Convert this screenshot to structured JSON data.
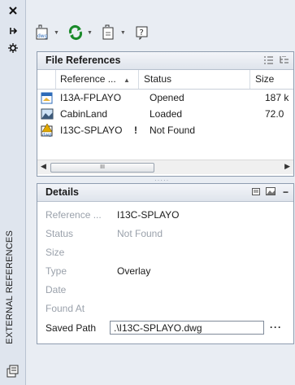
{
  "palette": {
    "title": "EXTERNAL REFERENCES",
    "buttons": {
      "close_icon": "close-icon",
      "autohide_icon": "autohide-icon",
      "properties_icon": "properties-icon"
    }
  },
  "toolbar": {
    "attach_icon": "attach-dwg-icon",
    "refresh_icon": "refresh-icon",
    "change_path_icon": "change-path-icon",
    "help_icon": "help-icon"
  },
  "file_references": {
    "title": "File References",
    "columns": [
      "Reference ...",
      "Status",
      "Size"
    ],
    "rows": [
      {
        "name": "I13A-FPLAYO",
        "status": "Opened",
        "size": "187 k",
        "icon": "drawing-icon",
        "warning": ""
      },
      {
        "name": "CabinLand",
        "status": "Loaded",
        "size": "72.0",
        "icon": "image-icon",
        "warning": ""
      },
      {
        "name": "I13C-SPLAYO",
        "status": "Not Found",
        "size": "",
        "icon": "dwg-warning-icon",
        "warning": "!"
      }
    ],
    "scroll_thumb": "III"
  },
  "details": {
    "title": "Details",
    "fields": [
      {
        "key": "Reference ...",
        "value": "I13C-SPLAYO"
      },
      {
        "key": "Status",
        "value": "Not Found"
      },
      {
        "key": "Size",
        "value": ""
      },
      {
        "key": "Type",
        "value": "Overlay"
      },
      {
        "key": "Date",
        "value": ""
      },
      {
        "key": "Found At",
        "value": ""
      },
      {
        "key": "Saved Path",
        "value": ".\\I13C-SPLAYO.dwg"
      }
    ],
    "browse_label": "···"
  },
  "colors": {
    "accent": "#2e6bb8",
    "green": "#1a8a2a",
    "warning": "#e0a800"
  }
}
